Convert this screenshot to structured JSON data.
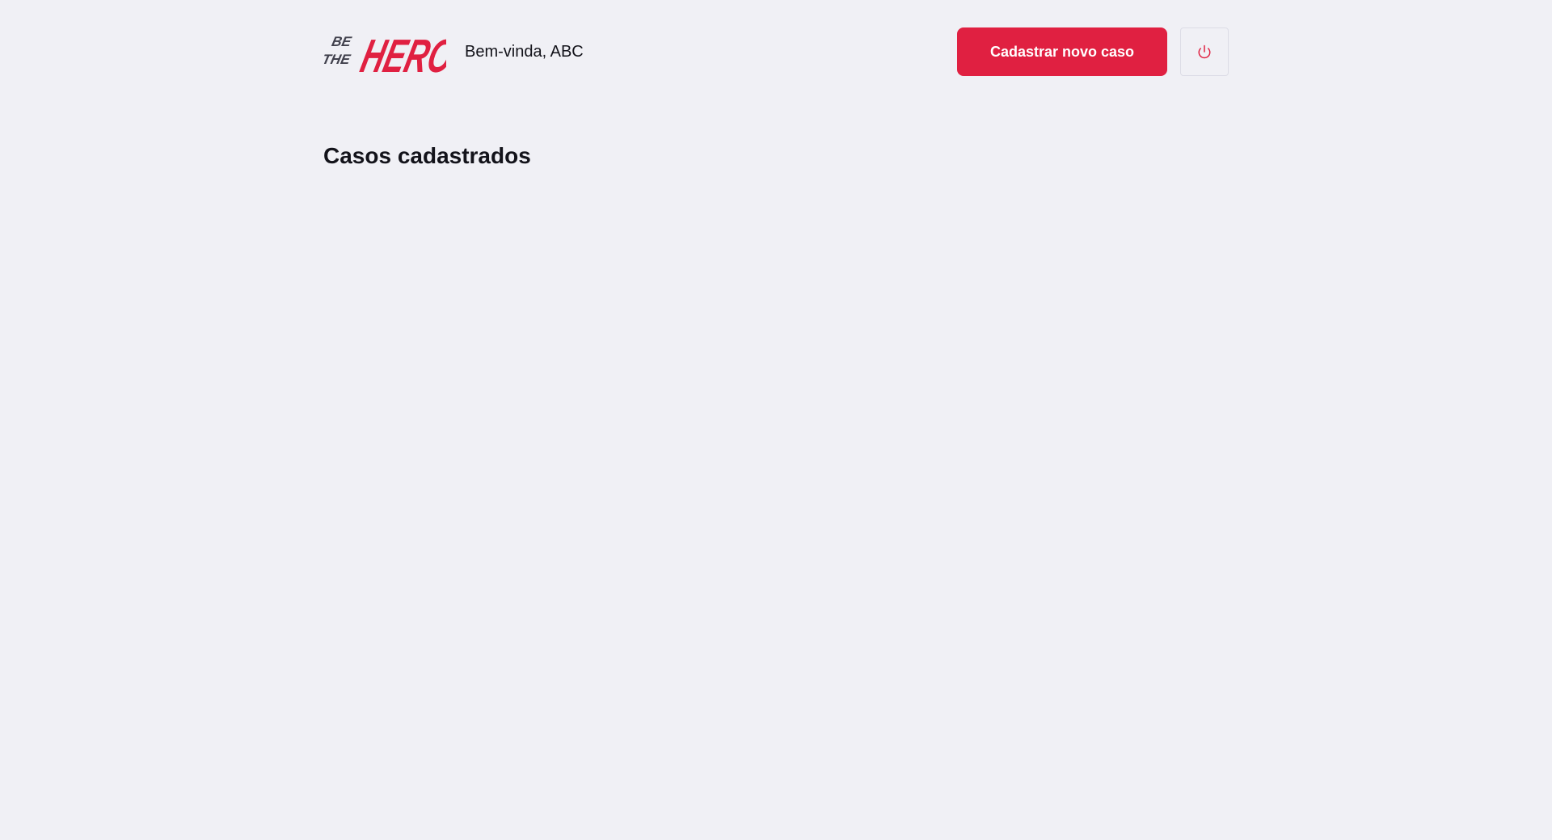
{
  "brand": {
    "logo_line1": "BE",
    "logo_line2": "THE",
    "logo_word": "HERO",
    "logo_alt": "Be The Hero",
    "primary_color": "#e02041",
    "dark_color": "#41414d"
  },
  "header": {
    "greeting": "Bem-vinda, ABC",
    "new_case_button": "Cadastrar novo caso",
    "logout_icon": "power-icon"
  },
  "main": {
    "title": "Casos cadastrados",
    "cases": []
  },
  "colors": {
    "background": "#f0f0f5",
    "text": "#13131a",
    "border": "#dcdce6"
  }
}
